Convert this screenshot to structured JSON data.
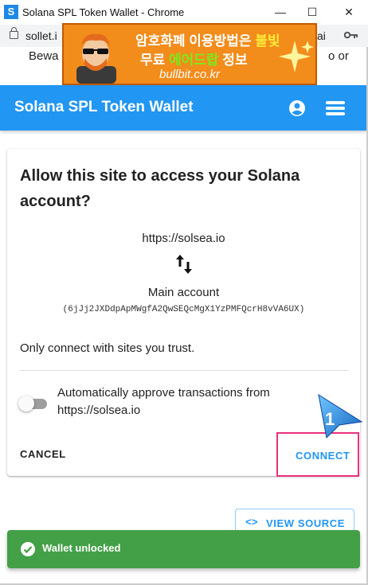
{
  "window": {
    "app_icon_letter": "S",
    "title": "Solana SPL Token Wallet - Chrome",
    "minimize": "—",
    "maximize": "☐",
    "close": "✕"
  },
  "address_bar": {
    "url": "sollet.i",
    "url_tail": "ai"
  },
  "page_behind": {
    "beware_left": "Bewa",
    "beware_right": "o or"
  },
  "ad": {
    "line1_a": "암호화폐 이용방법은 ",
    "line1_b": "불빛",
    "line2_a": "무료 ",
    "line2_b": "에어드랍",
    "line2_c": " 정보",
    "line3": "bullbit.co.kr"
  },
  "appbar": {
    "title": "Solana SPL Token Wallet"
  },
  "dialog": {
    "title": "Allow this site to access your Solana account?",
    "origin": "https://solsea.io",
    "account_name": "Main account",
    "account_key": "(6jJj2JXDdpApMWgfA2QwSEQcMgX1YzPMFQcrH8vVA6UX)",
    "trust_note": "Only connect with sites you trust.",
    "auto_approve_label": "Automatically approve transactions from https://solsea.io",
    "auto_approve_on": false,
    "cancel_label": "CANCEL",
    "connect_label": "CONNECT",
    "step_number": "1"
  },
  "view_source": {
    "icon": "<>",
    "label": "VIEW SOURCE"
  },
  "snackbar": {
    "message": "Wallet unlocked",
    "color": "#43a047"
  },
  "colors": {
    "primary": "#2196f3",
    "highlight_box": "#e8317c"
  }
}
